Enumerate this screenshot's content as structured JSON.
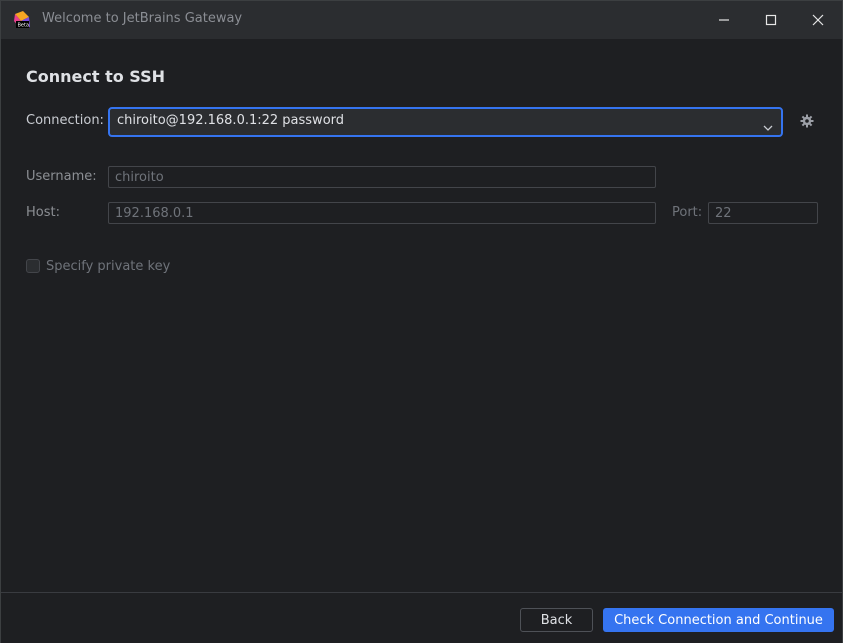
{
  "window": {
    "title": "Welcome to JetBrains Gateway",
    "app_icon": "jetbrains-gateway-beta-icon",
    "app_icon_badge": "Beta"
  },
  "page": {
    "heading": "Connect to SSH"
  },
  "connection": {
    "label": "Connection:",
    "value": "chiroito@192.168.0.1:22 password",
    "dropdown_icon": "chevron-down-icon",
    "settings_icon": "gear-icon"
  },
  "form": {
    "username_label": "Username:",
    "username_value": "chiroito",
    "host_label": "Host:",
    "host_value": "192.168.0.1",
    "port_label": "Port:",
    "port_value": "22",
    "private_key_label": "Specify private key",
    "private_key_checked": false
  },
  "footer": {
    "back_label": "Back",
    "primary_label": "Check Connection and Continue"
  },
  "colors": {
    "background": "#1e1f22",
    "titlebar": "#2b2d30",
    "accent": "#3574f0",
    "text": "#dfe1e5",
    "disabled_text": "#6f737a"
  }
}
